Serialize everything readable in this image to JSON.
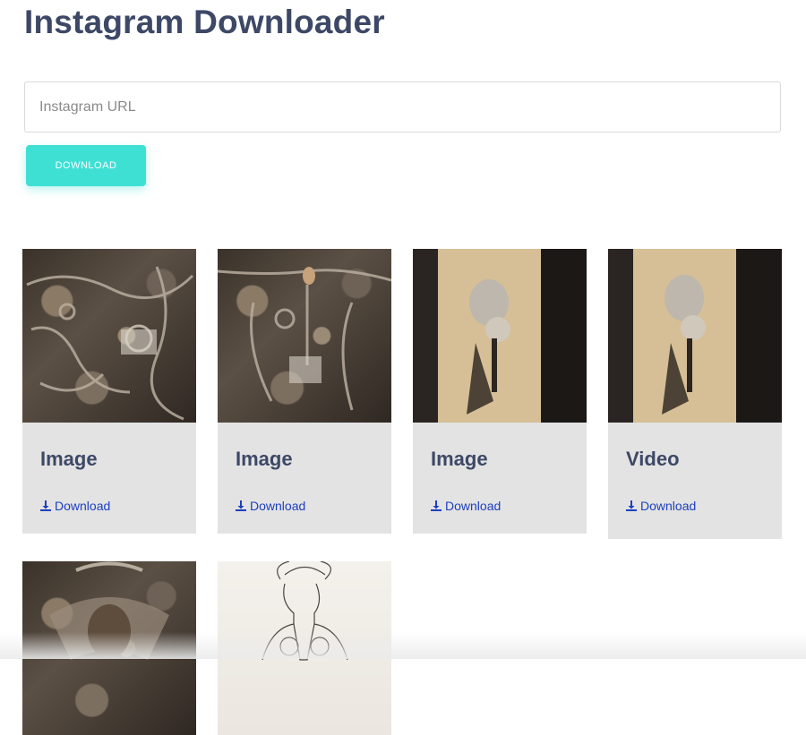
{
  "header": {
    "title": "Instagram Downloader"
  },
  "search": {
    "placeholder": "Instagram URL",
    "value": ""
  },
  "actions": {
    "download_label": "DOWNLOAD"
  },
  "results": [
    {
      "type": "Image",
      "link": "Download"
    },
    {
      "type": "Image",
      "link": "Download"
    },
    {
      "type": "Image",
      "link": "Download"
    },
    {
      "type": "Video",
      "link": "Download"
    }
  ],
  "colors": {
    "title": "#3d4866",
    "accent": "#3fe0d4",
    "card_bg": "#e3e3e3",
    "link": "#1d3fbf"
  },
  "icons": {
    "download": "download-icon"
  }
}
